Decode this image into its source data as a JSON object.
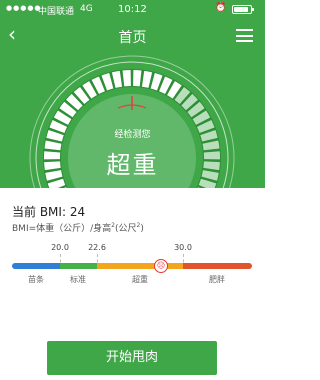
{
  "status_bar": {
    "signal": "●●●●●",
    "carrier": "中国联通",
    "network": "4G",
    "time": "10:12",
    "alarm": "⏰"
  },
  "nav": {
    "back_icon": "chevron-left-icon",
    "title": "首页",
    "menu_icon": "hamburger-menu-icon"
  },
  "gauge": {
    "label": "经检测您",
    "result": "超重",
    "level": 0.66
  },
  "bmi": {
    "current_label": "当前 BMI:",
    "current_value": "24",
    "formula_prefix": "BMI=体重（公斤）/身高",
    "formula_sup1": "2",
    "formula_mid": "(公尺",
    "formula_sup2": "2",
    "formula_end": ")"
  },
  "scale": {
    "thresholds": [
      "20.0",
      "22.6",
      "30.0"
    ],
    "categories": [
      "苗条",
      "标准",
      "超重",
      "肥胖"
    ],
    "colors": [
      "#2f7fd6",
      "#44b04a",
      "#f2a51d",
      "#e1532a"
    ],
    "marker_value": 24
  },
  "action": {
    "start_label": "开始甩肉"
  }
}
